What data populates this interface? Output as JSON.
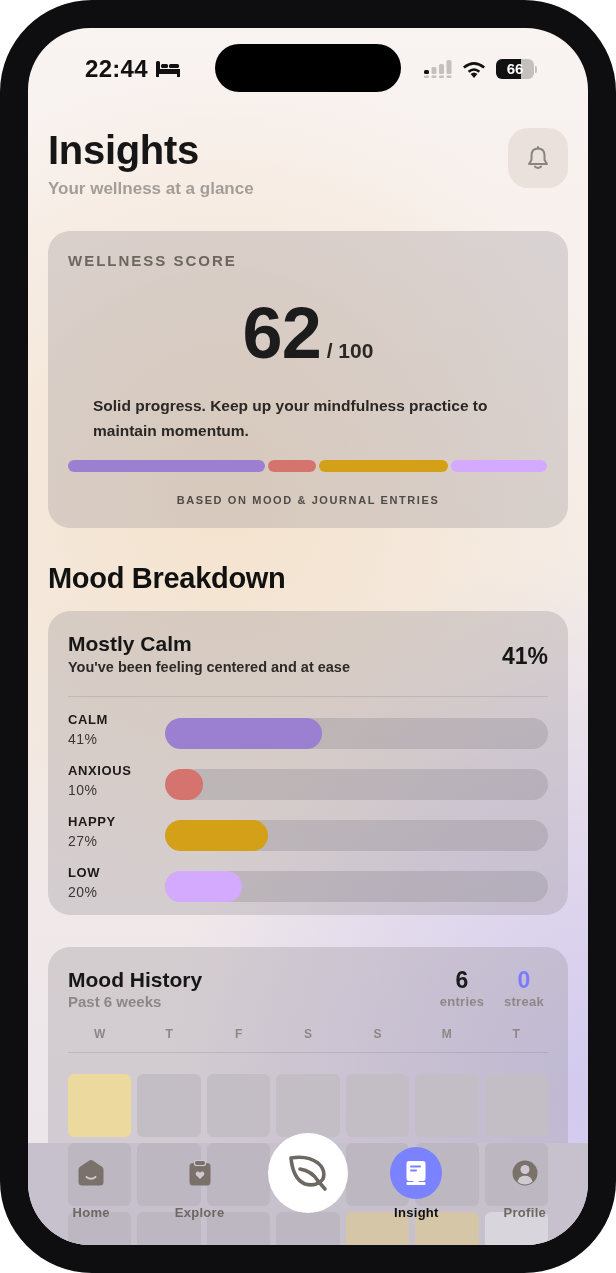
{
  "status_bar": {
    "time": "22:44",
    "battery": "66"
  },
  "header": {
    "title": "Insights",
    "subtitle": "Your wellness at a glance"
  },
  "wellness": {
    "label": "WELLNESS SCORE",
    "score": "62",
    "max": "/ 100",
    "message": "Solid progress. Keep up your mindfulness practice to maintain momentum.",
    "footer": "BASED ON MOOD & JOURNAL ENTRIES"
  },
  "mood_breakdown": {
    "title": "Mood Breakdown",
    "summary": {
      "title": "Mostly Calm",
      "subtitle": "You've been feeling centered and at ease",
      "percent": "41%"
    },
    "moods": [
      {
        "name": "CALM",
        "percent": "41%",
        "level": 0.41,
        "color": "#9b7fd0"
      },
      {
        "name": "ANXIOUS",
        "percent": "10%",
        "level": 0.1,
        "color": "#d5736e"
      },
      {
        "name": "HAPPY",
        "percent": "27%",
        "level": 0.27,
        "color": "#d4a017"
      },
      {
        "name": "LOW",
        "percent": "20%",
        "level": 0.2,
        "color": "#d4aaff"
      }
    ]
  },
  "mood_history": {
    "title": "Mood History",
    "subtitle": "Past 6 weeks",
    "stats": [
      {
        "value": "6",
        "label": "entries",
        "color": "#1c1c1c"
      },
      {
        "value": "0",
        "label": "streak",
        "color": "#7b7bff"
      }
    ],
    "weekdays": [
      "W",
      "T",
      "F",
      "S",
      "S",
      "M",
      "T"
    ],
    "weeks": [
      [
        {
          "kind": "day",
          "color": "#ecd99e"
        },
        {
          "kind": "day",
          "color": "#c3bec6"
        },
        {
          "kind": "day",
          "color": "#c3bec6"
        },
        {
          "kind": "day",
          "color": "#c3bec6"
        },
        {
          "kind": "day",
          "color": "#c3bec6"
        },
        {
          "kind": "day",
          "color": "#c3bec6"
        },
        {
          "kind": "day",
          "color": "#c3bec6"
        }
      ],
      [
        {
          "kind": "day",
          "color": "#bcb7c1"
        },
        {
          "kind": "day",
          "color": "#bcb7c1"
        },
        {
          "kind": "day",
          "color": "#bcb7c1"
        },
        {
          "kind": "hidden"
        },
        {
          "kind": "day",
          "color": "#bcb7c1"
        },
        {
          "kind": "day",
          "color": "#bcb7c1"
        },
        {
          "kind": "day",
          "color": "#bcb7c1"
        }
      ],
      [
        {
          "kind": "day",
          "color": "#bcb7c1"
        },
        {
          "kind": "day",
          "color": "#bcb7c1"
        },
        {
          "kind": "day",
          "color": "#bcb7c1"
        },
        {
          "kind": "day",
          "color": "#bcb7c1"
        },
        {
          "kind": "day",
          "color": "#d6c6a8"
        },
        {
          "kind": "day",
          "color": "#d6c6a8"
        },
        {
          "kind": "day",
          "color": "#d8d5dc"
        }
      ]
    ]
  },
  "nav": {
    "items": [
      {
        "kind": "tab",
        "label": "Home",
        "selected": false
      },
      {
        "kind": "tab",
        "label": "Explore",
        "selected": false
      },
      {
        "kind": "action"
      },
      {
        "kind": "tab",
        "label": "Insight",
        "selected": true
      },
      {
        "kind": "tab",
        "label": "Profile",
        "selected": false
      }
    ]
  }
}
